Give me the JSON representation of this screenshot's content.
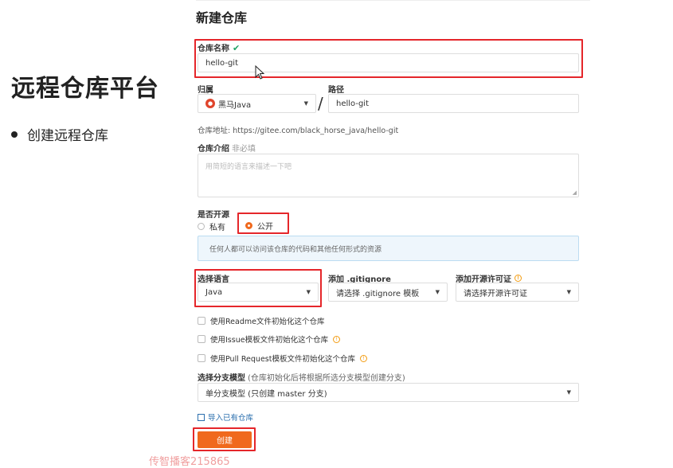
{
  "slide": {
    "title": "远程仓库平台",
    "bullet": "创建远程仓库"
  },
  "form": {
    "title": "新建仓库",
    "repo_name": {
      "label": "仓库名称",
      "check": "✔",
      "value": "hello-git"
    },
    "owner": {
      "label": "归属",
      "value": "黑马Java"
    },
    "path": {
      "label": "路径",
      "value": "hello-git"
    },
    "address": {
      "label": "仓库地址:",
      "value": "https://gitee.com/black_horse_java/hello-git"
    },
    "intro": {
      "label": "仓库介绍",
      "sub": "非必填",
      "placeholder": "用简短的语言来描述一下吧"
    },
    "open_source": {
      "label": "是否开源",
      "private": "私有",
      "public": "公开",
      "selected": "公开",
      "info": "任何人都可以访问该仓库的代码和其他任何形式的资源"
    },
    "language": {
      "label": "选择语言",
      "value": "Java"
    },
    "gitignore": {
      "label": "添加 .gitignore",
      "value": "请选择 .gitignore 模板"
    },
    "license": {
      "label": "添加开源许可证",
      "value": "请选择开源许可证"
    },
    "checkboxes": [
      "使用Readme文件初始化这个仓库",
      "使用Issue模板文件初始化这个仓库",
      "使用Pull Request模板文件初始化这个仓库"
    ],
    "branch_model": {
      "label": "选择分支模型",
      "sub": "(仓库初始化后将根据所选分支模型创建分支)",
      "value": "单分支模型 (只创建 master 分支)"
    },
    "import_link": "导入已有仓库",
    "create_button": "创建"
  },
  "watermark": "传智播客215865",
  "colors": {
    "accent": "#f0691d",
    "highlight": "#e5262a",
    "success": "#21a366",
    "link": "#2b6fae"
  }
}
